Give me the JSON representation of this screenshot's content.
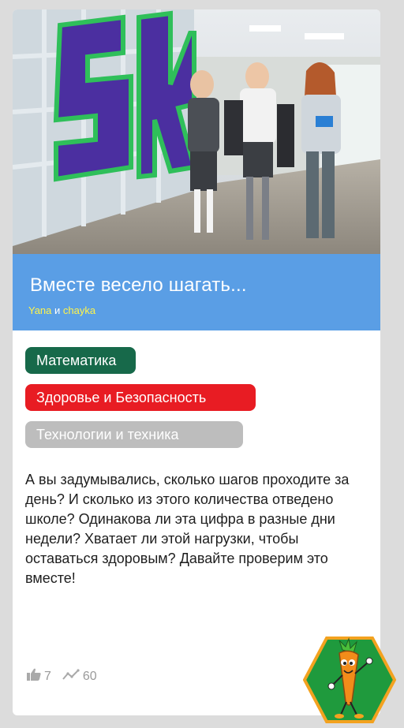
{
  "card": {
    "title": "Вместе весело шагать...",
    "authors": {
      "first": "Yana",
      "conjunction": " и ",
      "second": "chayka"
    },
    "tags": [
      {
        "label": "Математика",
        "color": "#17694a"
      },
      {
        "label": "Здоровье и Безопасность",
        "color": "#e81c23"
      },
      {
        "label": "Технологии и техника",
        "color": "#bdbdbd"
      }
    ],
    "description": "А вы задумывались, сколько шагов проходите за день? И сколько из этого количества отведено школе? Одинакова ли эта цифра в разные дни недели? Хватает ли этой нагрузки, чтобы оставаться здоровым? Давайте проверим это вместе!",
    "stats": {
      "likes": "7",
      "views": "60"
    },
    "banner_color": "#5a9ee5"
  },
  "icons": {
    "like": "thumbs-up-icon",
    "views": "trend-line-icon",
    "badge": "carrot-mascot-icon"
  }
}
